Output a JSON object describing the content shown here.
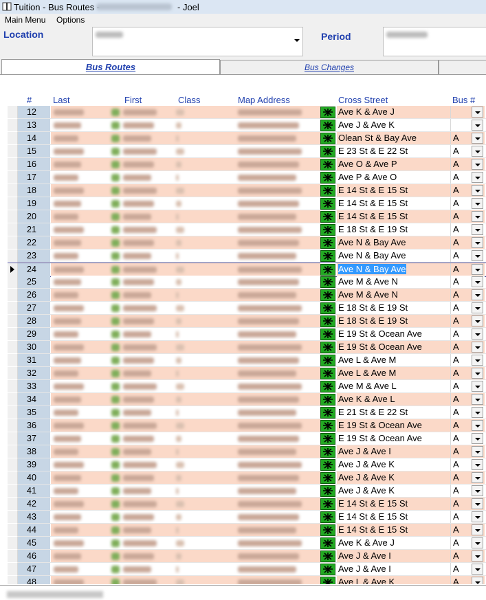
{
  "window": {
    "title_prefix": "Tuition - Bus Routes -",
    "title_user": "- Joel"
  },
  "menu": {
    "main": "Main Menu",
    "options": "Options"
  },
  "filters": {
    "location_label": "Location",
    "period_label": "Period"
  },
  "tabs": [
    {
      "label": "Bus Routes",
      "active": true
    },
    {
      "label": "Bus Changes",
      "active": false
    }
  ],
  "columns": {
    "num": "#",
    "last": "Last",
    "first": "First",
    "class": "Class",
    "map": "Map Address",
    "cross": "Cross Street",
    "bus": "Bus #"
  },
  "colors": {
    "accent": "#1f3fae",
    "row_alt": "#fbd9c8",
    "row_num_bg": "#c7d6e5",
    "selection": "#3399ff"
  },
  "current_row": 24,
  "rows": [
    {
      "num": "12",
      "cross": "Ave K & Ave J",
      "bus": ""
    },
    {
      "num": "13",
      "cross": "Ave J & Ave K",
      "bus": ""
    },
    {
      "num": "14",
      "cross": "Olean St & Bay Ave",
      "bus": "A"
    },
    {
      "num": "15",
      "cross": "E 23 St & E 22 St",
      "bus": "A"
    },
    {
      "num": "16",
      "cross": "Ave O & Ave P",
      "bus": "A"
    },
    {
      "num": "17",
      "cross": "Ave P & Ave O",
      "bus": "A"
    },
    {
      "num": "18",
      "cross": "E 14 St & E 15 St",
      "bus": "A"
    },
    {
      "num": "19",
      "cross": "E 14 St & E 15 St",
      "bus": "A"
    },
    {
      "num": "20",
      "cross": "E 14 St & E 15 St",
      "bus": "A"
    },
    {
      "num": "21",
      "cross": "E 18 St & E 19 St",
      "bus": "A"
    },
    {
      "num": "22",
      "cross": "Ave N & Bay Ave",
      "bus": "A"
    },
    {
      "num": "23",
      "cross": "Ave N & Bay Ave",
      "bus": "A"
    },
    {
      "num": "24",
      "cross": "Ave N & Bay Ave",
      "bus": "A"
    },
    {
      "num": "25",
      "cross": "Ave M & Ave N",
      "bus": "A"
    },
    {
      "num": "26",
      "cross": "Ave M & Ave N",
      "bus": "A"
    },
    {
      "num": "27",
      "cross": "E 18 St & E 19 St",
      "bus": "A"
    },
    {
      "num": "28",
      "cross": "E 18 St & E 19 St",
      "bus": "A"
    },
    {
      "num": "29",
      "cross": "E 19 St & Ocean Ave",
      "bus": "A"
    },
    {
      "num": "30",
      "cross": "E 19 St & Ocean Ave",
      "bus": "A"
    },
    {
      "num": "31",
      "cross": "Ave L & Ave M",
      "bus": "A"
    },
    {
      "num": "32",
      "cross": "Ave L & Ave M",
      "bus": "A"
    },
    {
      "num": "33",
      "cross": "Ave M & Ave L",
      "bus": "A"
    },
    {
      "num": "34",
      "cross": "Ave K & Ave L",
      "bus": "A"
    },
    {
      "num": "35",
      "cross": "E 21 St & E 22 St",
      "bus": "A"
    },
    {
      "num": "36",
      "cross": "E 19 St & Ocean Ave",
      "bus": "A"
    },
    {
      "num": "37",
      "cross": "E 19 St & Ocean Ave",
      "bus": "A"
    },
    {
      "num": "38",
      "cross": "Ave J & Ave I",
      "bus": "A"
    },
    {
      "num": "39",
      "cross": "Ave J & Ave K",
      "bus": "A"
    },
    {
      "num": "40",
      "cross": "Ave J & Ave K",
      "bus": "A"
    },
    {
      "num": "41",
      "cross": "Ave J & Ave K",
      "bus": "A"
    },
    {
      "num": "42",
      "cross": "E 14 St & E 15 St",
      "bus": "A"
    },
    {
      "num": "43",
      "cross": "E 14 St & E 15 St",
      "bus": "A"
    },
    {
      "num": "44",
      "cross": "E 14 St & E 15 St",
      "bus": "A"
    },
    {
      "num": "45",
      "cross": "Ave K & Ave J",
      "bus": "A"
    },
    {
      "num": "46",
      "cross": "Ave J & Ave I",
      "bus": "A"
    },
    {
      "num": "47",
      "cross": "Ave J & Ave I",
      "bus": "A"
    },
    {
      "num": "48",
      "cross": "Ave L & Ave K",
      "bus": "A"
    }
  ]
}
